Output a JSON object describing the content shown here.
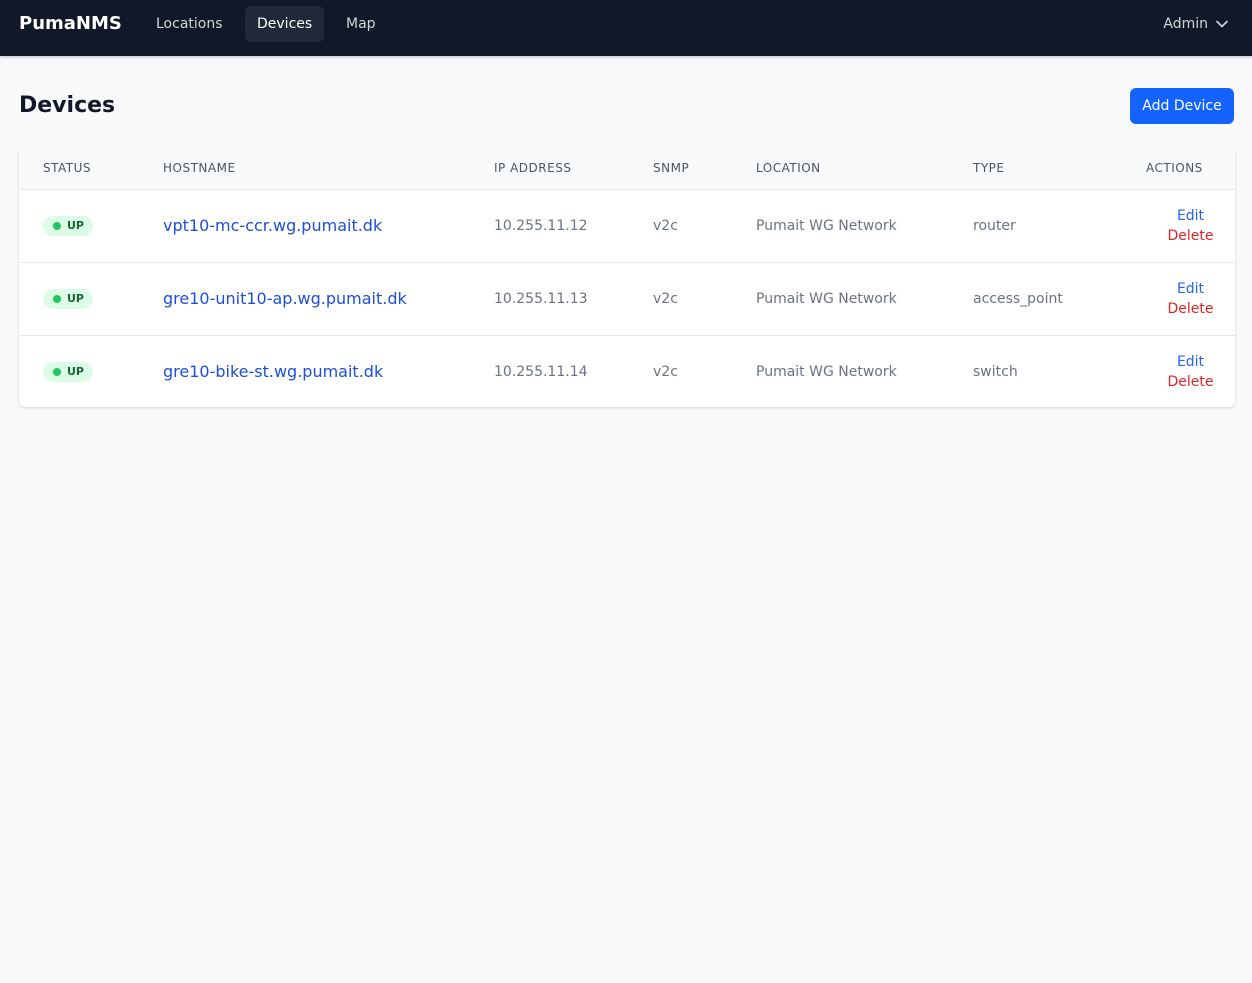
{
  "nav": {
    "brand": "PumaNMS",
    "items": [
      {
        "label": "Locations"
      },
      {
        "label": "Devices"
      },
      {
        "label": "Map"
      }
    ],
    "user": "Admin"
  },
  "page": {
    "title": "Devices",
    "add_button": "Add Device"
  },
  "table": {
    "headers": [
      "STATUS",
      "HOSTNAME",
      "IP ADDRESS",
      "SNMP",
      "LOCATION",
      "TYPE",
      "ACTIONS"
    ],
    "rows": [
      {
        "status": "UP",
        "hostname": "vpt10-mc-ccr.wg.pumait.dk",
        "ip": "10.255.11.12",
        "snmp": "v2c",
        "location": "Pumait WG Network",
        "type": "router",
        "edit": "Edit",
        "delete": "Delete"
      },
      {
        "status": "UP",
        "hostname": "gre10-unit10-ap.wg.pumait.dk",
        "ip": "10.255.11.13",
        "snmp": "v2c",
        "location": "Pumait WG Network",
        "type": "access_point",
        "edit": "Edit",
        "delete": "Delete"
      },
      {
        "status": "UP",
        "hostname": "gre10-bike-st.wg.pumait.dk",
        "ip": "10.255.11.14",
        "snmp": "v2c",
        "location": "Pumait WG Network",
        "type": "switch",
        "edit": "Edit",
        "delete": "Delete"
      }
    ]
  },
  "colors": {
    "nav_bg": "#111827",
    "accent": "#1463ff",
    "status_up": "#22c55e",
    "delete": "#dc2626"
  }
}
